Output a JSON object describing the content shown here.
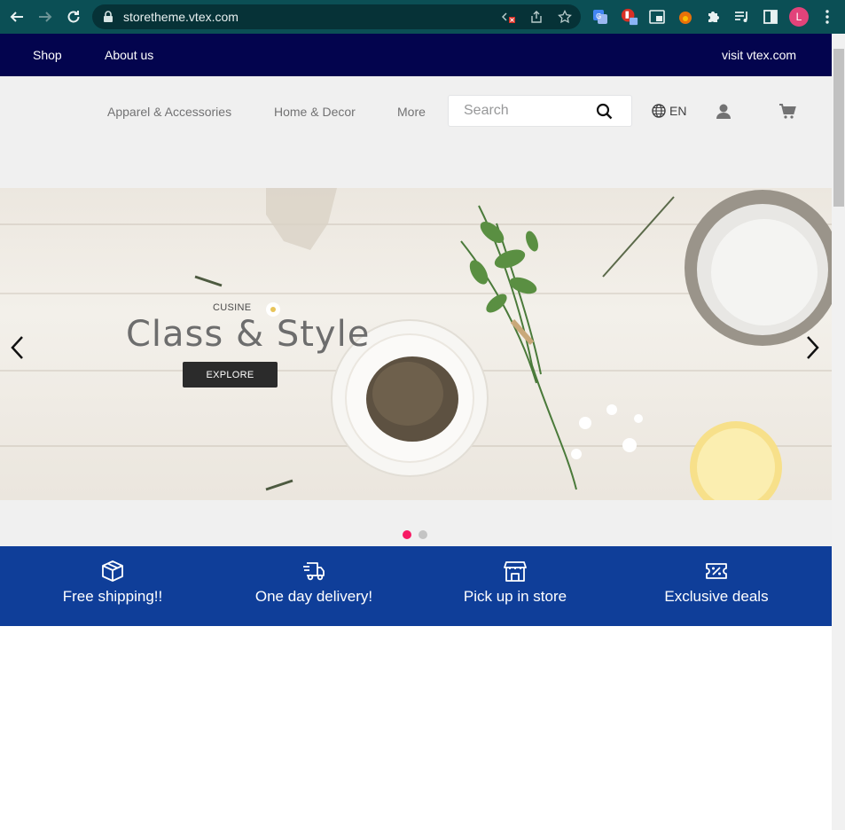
{
  "browser": {
    "url": "storetheme.vtex.com",
    "profile_initial": "L"
  },
  "topbar": {
    "shop": "Shop",
    "about": "About us",
    "visit": "visit vtex.com"
  },
  "header": {
    "menu": [
      "Apparel & Accessories",
      "Home & Decor",
      "More"
    ],
    "search_placeholder": "Search",
    "language": "EN"
  },
  "hero": {
    "subtitle": "CUSINE",
    "title": "Class & Style",
    "button": "EXPLORE",
    "active_slide": 1,
    "slide_count": 2
  },
  "info": {
    "items": [
      "Free shipping!!",
      "One day delivery!",
      "Pick up in store",
      "Exclusive deals"
    ]
  },
  "colors": {
    "topbar_bg": "#03044e",
    "infobar_bg": "#0f3e99",
    "dot_active": "#f71963",
    "dot_inactive": "#c4c4c4",
    "chrome_bg": "#0b4f55"
  }
}
